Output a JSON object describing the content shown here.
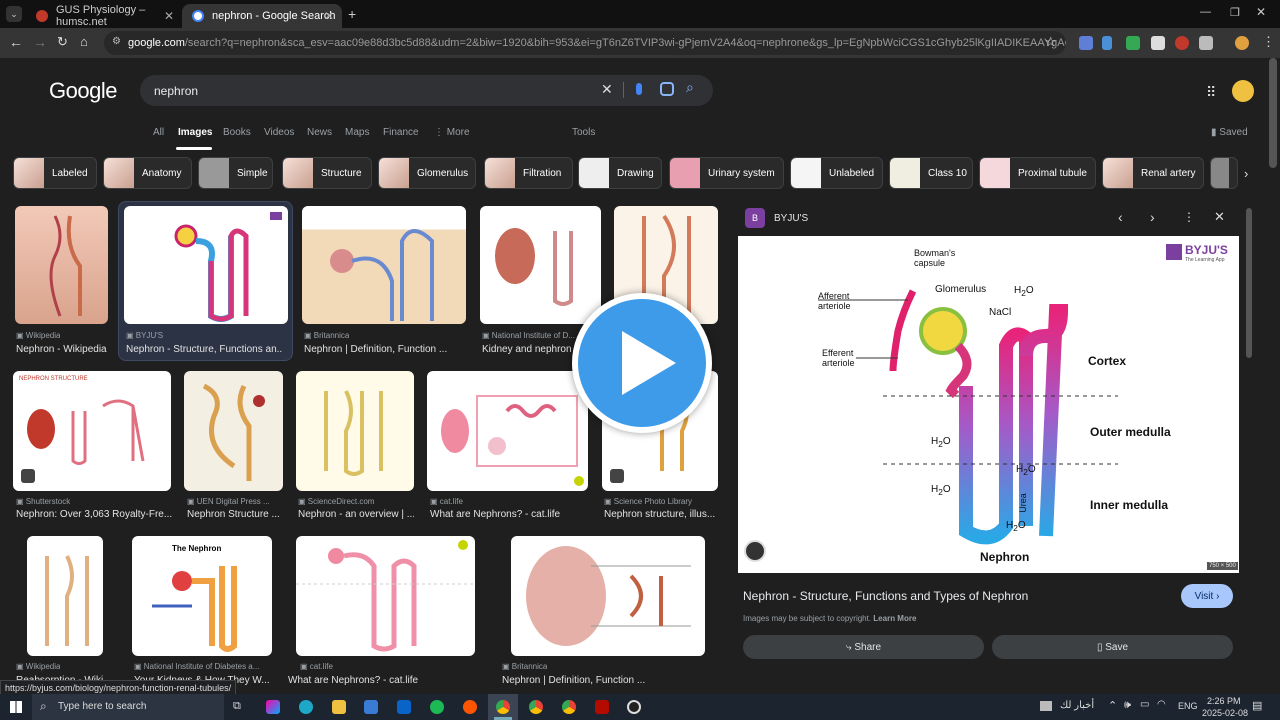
{
  "browser": {
    "tabs": [
      {
        "title": "GUS Physiology – humsc.net",
        "active": false
      },
      {
        "title": "nephron - Google Search",
        "active": true
      }
    ],
    "new_tab": "+",
    "url_domain": "google.com",
    "url_rest": "/search?q=nephron&sca_esv=aac09e88d3bc5d88&udm=2&biw=1920&bih=953&ei=gT6nZ6TVIP3wi-gPjemV2A4&oq=nephrone&gs_lp=EgNpbWciCGS1cGhyb25lKgIIADIKEAAYgAQYQxiKBTIHEAAYgAQYCjIHE..."
  },
  "search": {
    "logo": "Google",
    "query": "nephron",
    "tabs": [
      "All",
      "Images",
      "Books",
      "Videos",
      "News",
      "Maps",
      "Finance",
      "More"
    ],
    "selected_tab": "Images",
    "tools": "Tools",
    "saved": "Saved"
  },
  "chips": [
    "Labeled",
    "Anatomy",
    "Simple",
    "Structure",
    "Glomerulus",
    "Filtration",
    "Drawing",
    "Urinary system",
    "Unlabeled",
    "Class 10",
    "Proximal tubule",
    "Renal artery"
  ],
  "results": [
    {
      "source": "Wikipedia",
      "title": "Nephron - Wikipedia"
    },
    {
      "source": "BYJU'S",
      "title": "Nephron - Structure, Functions an..."
    },
    {
      "source": "Britannica",
      "title": "Nephron | Definition, Function ..."
    },
    {
      "source": "National Institute of D...",
      "title": "Kidney and nephron"
    },
    {
      "source": "Shutterstock",
      "title": "Nephron: Over 3,063 Royalty-Fre..."
    },
    {
      "source": "UEN Digital Press ...",
      "title": "Nephron Structure ..."
    },
    {
      "source": "ScienceDirect.com",
      "title": "Nephron - an overview | ..."
    },
    {
      "source": "cat.life",
      "title": "What are Nephrons? - cat.life"
    },
    {
      "source": "Science Photo Library",
      "title": "Nephron structure, illus..."
    },
    {
      "source": "Wikipedia",
      "title": "Reabsorption - Wiki..."
    },
    {
      "source": "National Institute of Diabetes a...",
      "title": "Your Kidneys & How They W..."
    },
    {
      "source": "cat.life",
      "title": "What are Nephrons? - cat.life"
    },
    {
      "source": "Britannica",
      "title": "Nephron | Definition, Function ..."
    }
  ],
  "thumb_labels": {
    "nephron_structure": "NEPHRON STRUCTURE",
    "the_nephron": "The Nephron"
  },
  "panel": {
    "source": "BYJU'S",
    "image_size": "750 × 500",
    "title": "Nephron - Structure, Functions and Types of Nephron",
    "visit": "Visit",
    "copyright": "Images may be subject to copyright.",
    "learn_more": "Learn More",
    "share": "Share",
    "save": "Save",
    "diagram": {
      "brand": "BYJU'S",
      "tagline": "The Learning App",
      "labels": [
        "Bowman's capsule",
        "Glomerulus",
        "Afferent arteriole",
        "Efferent arteriole",
        "NaCl",
        "Cortex",
        "Outer medulla",
        "Inner medulla",
        "Urea",
        "Nephron"
      ]
    }
  },
  "status_url": "https://byjus.com/biology/nephron-function-renal-tubules/",
  "taskbar": {
    "search_placeholder": "Type here to search",
    "news": "أخبار لك",
    "lang": "ENG",
    "time": "2:26 PM",
    "date": "2025-02-08"
  },
  "colors": {
    "accent": "#8ab4f8",
    "play": "#3d9be9",
    "byjus": "#7b3fa0"
  }
}
